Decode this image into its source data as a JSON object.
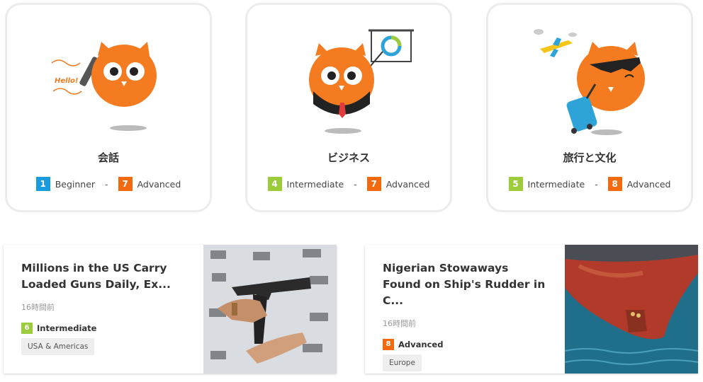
{
  "categories": [
    {
      "title": "会話",
      "bubble": "Hello!",
      "from": {
        "num": "1",
        "label": "Beginner",
        "color": "#1a9be0"
      },
      "to": {
        "num": "7",
        "label": "Advanced",
        "color": "#f26a10"
      }
    },
    {
      "title": "ビジネス",
      "from": {
        "num": "4",
        "label": "Intermediate",
        "color": "#9ccc3c"
      },
      "to": {
        "num": "7",
        "label": "Advanced",
        "color": "#f26a10"
      }
    },
    {
      "title": "旅行と文化",
      "from": {
        "num": "5",
        "label": "Intermediate",
        "color": "#9ccc3c"
      },
      "to": {
        "num": "8",
        "label": "Advanced",
        "color": "#f26a10"
      }
    }
  ],
  "separator": "-",
  "news": [
    {
      "title": "Millions in the US Carry Loaded Guns Daily, Ex...",
      "time": "16時間前",
      "level": {
        "num": "6",
        "label": "Intermediate",
        "color": "#9ccc3c"
      },
      "tag": "USA & Americas"
    },
    {
      "title": "Nigerian Stowaways Found on Ship's Rudder in C...",
      "time": "16時間前",
      "level": {
        "num": "8",
        "label": "Advanced",
        "color": "#f26a10"
      },
      "tag": "Europe"
    }
  ],
  "colors": {
    "owl": "#f47b20",
    "owl_dark": "#e06510",
    "card_border": "#ececec"
  }
}
